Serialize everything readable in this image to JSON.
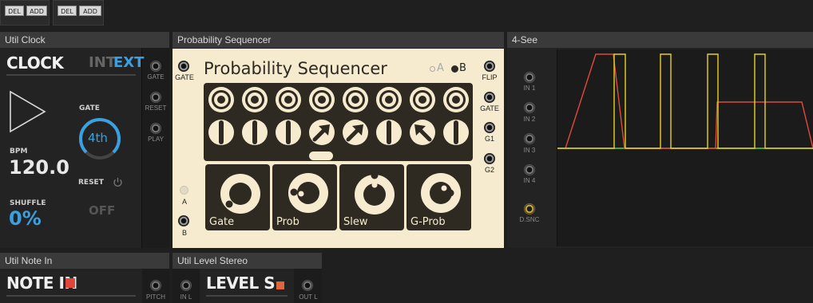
{
  "topbar": {
    "group1": {
      "del": "DEL",
      "add": "ADD"
    },
    "group2": {
      "del": "DEL",
      "add": "ADD"
    }
  },
  "util_clock": {
    "header": "Util Clock",
    "title": "CLOCK",
    "mode_int": "INT",
    "mode_ext": "EXT",
    "gate_label": "GATE",
    "gate_value": "4th",
    "bpm_label": "BPM",
    "bpm_value": "120.0",
    "reset_label": "RESET",
    "shuffle_label": "SHUFFLE",
    "shuffle_value": "0%",
    "off_label": "OFF",
    "jacks": [
      "GATE",
      "RESET",
      "PLAY"
    ]
  },
  "prob_seq": {
    "header": "Probability Sequencer",
    "title": "Probability Sequencer",
    "opt_a": "A",
    "opt_b": "B",
    "left_jacks": {
      "gate": "GATE",
      "a": "A",
      "b": "B"
    },
    "right_jacks": [
      "FLIP",
      "GATE",
      "G1",
      "G2"
    ],
    "steps_top": [
      "ring",
      "ring",
      "ring",
      "ring",
      "ring",
      "ring",
      "ring",
      "ring"
    ],
    "steps_mid": [
      "bar",
      "bar",
      "bar",
      "arrow-ne",
      "arrow-ne",
      "bar",
      "arrow-nw",
      "bar"
    ],
    "knobs": [
      "Gate",
      "Prob",
      "Slew",
      "G-Prob"
    ]
  },
  "four_see": {
    "header": "4-See",
    "inputs": [
      "IN 1",
      "IN 2",
      "IN 3",
      "IN 4"
    ],
    "dsnc": "D.SNC"
  },
  "note_in": {
    "header": "Util Note In",
    "title": "NOTE IN",
    "jack": "PITCH"
  },
  "level_stereo": {
    "header": "Util Level Stereo",
    "title": "LEVEL S",
    "jack_in": "IN L",
    "jack_out": "OUT L"
  },
  "colors": {
    "accent": "#3aa0e0",
    "red": "#e0463a",
    "cream": "#f6ebcf",
    "trace_red": "#e04a3a",
    "trace_yellow": "#e8d020",
    "trace_green": "#6ad030"
  }
}
